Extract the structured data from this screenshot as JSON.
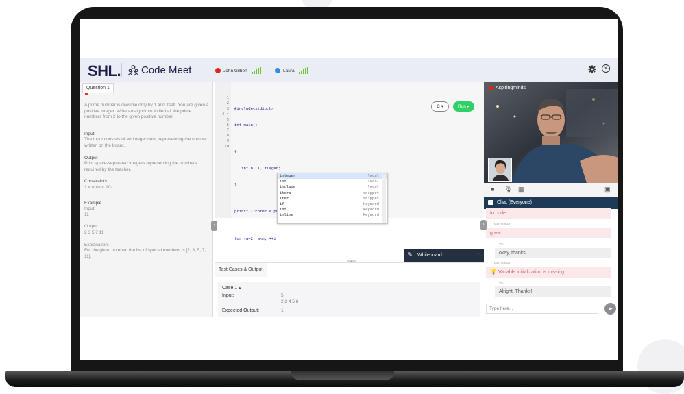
{
  "header": {
    "logo": "SHL.",
    "app_title": "Code Meet",
    "participants": [
      {
        "name": "John Gilbert",
        "color": "#e1251b"
      },
      {
        "name": "Laura",
        "color": "#2f8ce8"
      }
    ]
  },
  "question": {
    "tab_label": "Question 1",
    "intro": "A prime number is divisible only by 1 and itself. You are given a positive integer. Write an algorithm to find all the prime numbers from 2 to the given positive number.",
    "input_heading": "Input",
    "input_text": "The input consists of an integer num, representing the number written on the board.",
    "output_heading": "Output",
    "output_text": "Print space-separated integers representing the numbers required by the teacher.",
    "constraints_heading": "Constraints",
    "constraints_text": "1 < num < 10⁵",
    "example_heading": "Example",
    "example_input_label": "Input:",
    "example_input_value": "11",
    "example_output_label": "Output:",
    "example_output_value": "2 3 5 7 11",
    "explanation_label": "Explanation:",
    "explanation_text": "For the given number, the list of special numbers is [2, 3, 5, 7, 11]."
  },
  "editor": {
    "line_numbers": [
      "1",
      "2",
      "3",
      "4 ▾",
      "5",
      "6",
      "7",
      "8",
      "9",
      "10"
    ],
    "lines": [
      "#include<stdio.h>",
      "int main()",
      "",
      "{",
      "   int n, i, flag=0;",
      "}",
      "",
      "printf (\"Enter a positve integer\")",
      "",
      "for (a=2; a<n; ++i"
    ],
    "language_label": "C ▾",
    "run_label": "Run ▸"
  },
  "autocomplete": [
    {
      "label": "integer",
      "kind": "local",
      "selected": true
    },
    {
      "label": "int",
      "kind": "local"
    },
    {
      "label": "include",
      "kind": "local"
    },
    {
      "label": "itera",
      "kind": "snippet"
    },
    {
      "label": "iter",
      "kind": "snippet"
    },
    {
      "label": "if",
      "kind": "keyword"
    },
    {
      "label": "int",
      "kind": "keyword"
    },
    {
      "label": "inline",
      "kind": "keyword"
    }
  ],
  "whiteboard": {
    "label": "Whiteboard",
    "minimize": "–"
  },
  "test_cases": {
    "tab_label": "Test Cases & Output",
    "case_title": "Case 1  ▴",
    "input_label": "Input:",
    "input_values": [
      "5",
      "2 3 4 5 6"
    ],
    "expected_label": "Expected Output:",
    "expected_value": "1"
  },
  "video": {
    "name": "Aspiringminds"
  },
  "chat": {
    "title": "Chat (Everyone)",
    "messages": [
      {
        "sender": "",
        "text": "to code",
        "style": "pink"
      },
      {
        "sender": "John Gilbert",
        "text": "great",
        "style": "pink"
      },
      {
        "sender": "You",
        "text": "okay, thanks",
        "style": "grey"
      },
      {
        "sender": "John Gilbert",
        "text": "Variable initialization is missing",
        "style": "pink"
      },
      {
        "sender": "You",
        "text": "Alright, Thanks!",
        "style": "grey"
      }
    ],
    "input_placeholder": "Type here...",
    "send_icon": "send-icon"
  }
}
